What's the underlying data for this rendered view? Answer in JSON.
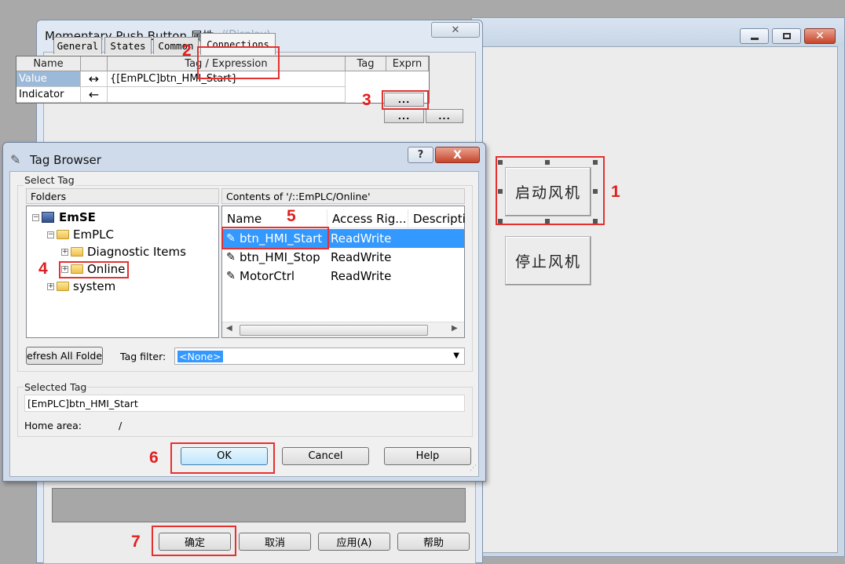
{
  "display_window": {
    "buttons": {
      "start": "启动风机",
      "stop": "停止风机"
    }
  },
  "props_dialog": {
    "title": "Momentary Push Button 属性",
    "title_faded": "- /(Display)",
    "tabs": [
      "General",
      "States",
      "Common",
      "Connections"
    ],
    "grid": {
      "headers": {
        "name": "Name",
        "arrow": "",
        "tag_expression": "Tag / Expression",
        "tag": "Tag",
        "exprn": "Exprn"
      },
      "rows": [
        {
          "name": "Value",
          "arrow": "↔",
          "expression": "{[EmPLC]btn_HMI_Start}"
        },
        {
          "name": "Indicator",
          "arrow": "←",
          "expression": ""
        }
      ],
      "dots": "..."
    },
    "buttons": {
      "ok": "确定",
      "cancel": "取消",
      "apply": "应用(A)",
      "help": "帮助"
    }
  },
  "tag_browser": {
    "title": "Tag Browser",
    "help_glyph": "?",
    "close_glyph": "X",
    "select_tag_label": "Select Tag",
    "folders_header": "Folders",
    "contents_header": "Contents of '/::EmPLC/Online'",
    "tree": {
      "root": "EmSE",
      "emplc": "EmPLC",
      "diagnostic": "Diagnostic Items",
      "online": "Online",
      "system": "system"
    },
    "columns": {
      "name": "Name",
      "access": "Access Rig...",
      "description": "Descripti"
    },
    "tags": [
      {
        "name": "btn_HMI_Start",
        "access": "ReadWrite"
      },
      {
        "name": "btn_HMI_Stop",
        "access": "ReadWrite"
      },
      {
        "name": "MotorCtrl",
        "access": "ReadWrite"
      }
    ],
    "refresh_button": "efresh All Folde",
    "tag_filter_label": "Tag filter:",
    "tag_filter_value": "<None>",
    "selected_tag_label": "Selected Tag",
    "selected_tag_value": "[EmPLC]btn_HMI_Start",
    "home_area_label": "Home area:",
    "home_area_value": "/",
    "buttons": {
      "ok": "OK",
      "cancel": "Cancel",
      "help": "Help"
    }
  },
  "annotations": [
    "1",
    "2",
    "3",
    "4",
    "5",
    "6",
    "7"
  ],
  "colors": {
    "annotation": "#e53030",
    "selection": "#3399ff"
  }
}
